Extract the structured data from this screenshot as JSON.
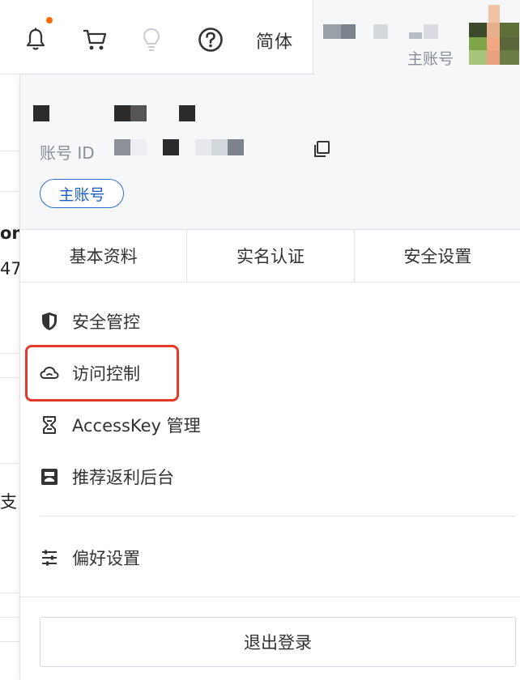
{
  "topbar": {
    "icons": [
      "bell-icon",
      "cart-icon",
      "lightbulb-icon",
      "help-icon"
    ],
    "notification_dot_color": "#ff6a00",
    "language_label": "简体",
    "account_role_label": "主账号"
  },
  "background_page": {
    "partial_texts": [
      "on",
      "47",
      "支"
    ]
  },
  "dropdown": {
    "account_id_label": "账号 ID",
    "role_tag": "主账号",
    "tabs": [
      {
        "label": "基本资料"
      },
      {
        "label": "实名认证"
      },
      {
        "label": "安全设置"
      }
    ],
    "menu": [
      {
        "label": "安全管控",
        "icon": "shield-icon"
      },
      {
        "label": "访问控制",
        "icon": "cloud-icon",
        "highlighted": true
      },
      {
        "label": "AccessKey 管理",
        "icon": "key-icon"
      },
      {
        "label": "推荐返利后台",
        "icon": "dashboard-icon"
      }
    ],
    "preferences": {
      "label": "偏好设置",
      "icon": "sliders-icon"
    },
    "logout_label": "退出登录"
  },
  "colors": {
    "accent_blue": "#1d5fc9",
    "highlight_red": "#e4392b",
    "panel_head_bg": "#f6f7f9"
  }
}
